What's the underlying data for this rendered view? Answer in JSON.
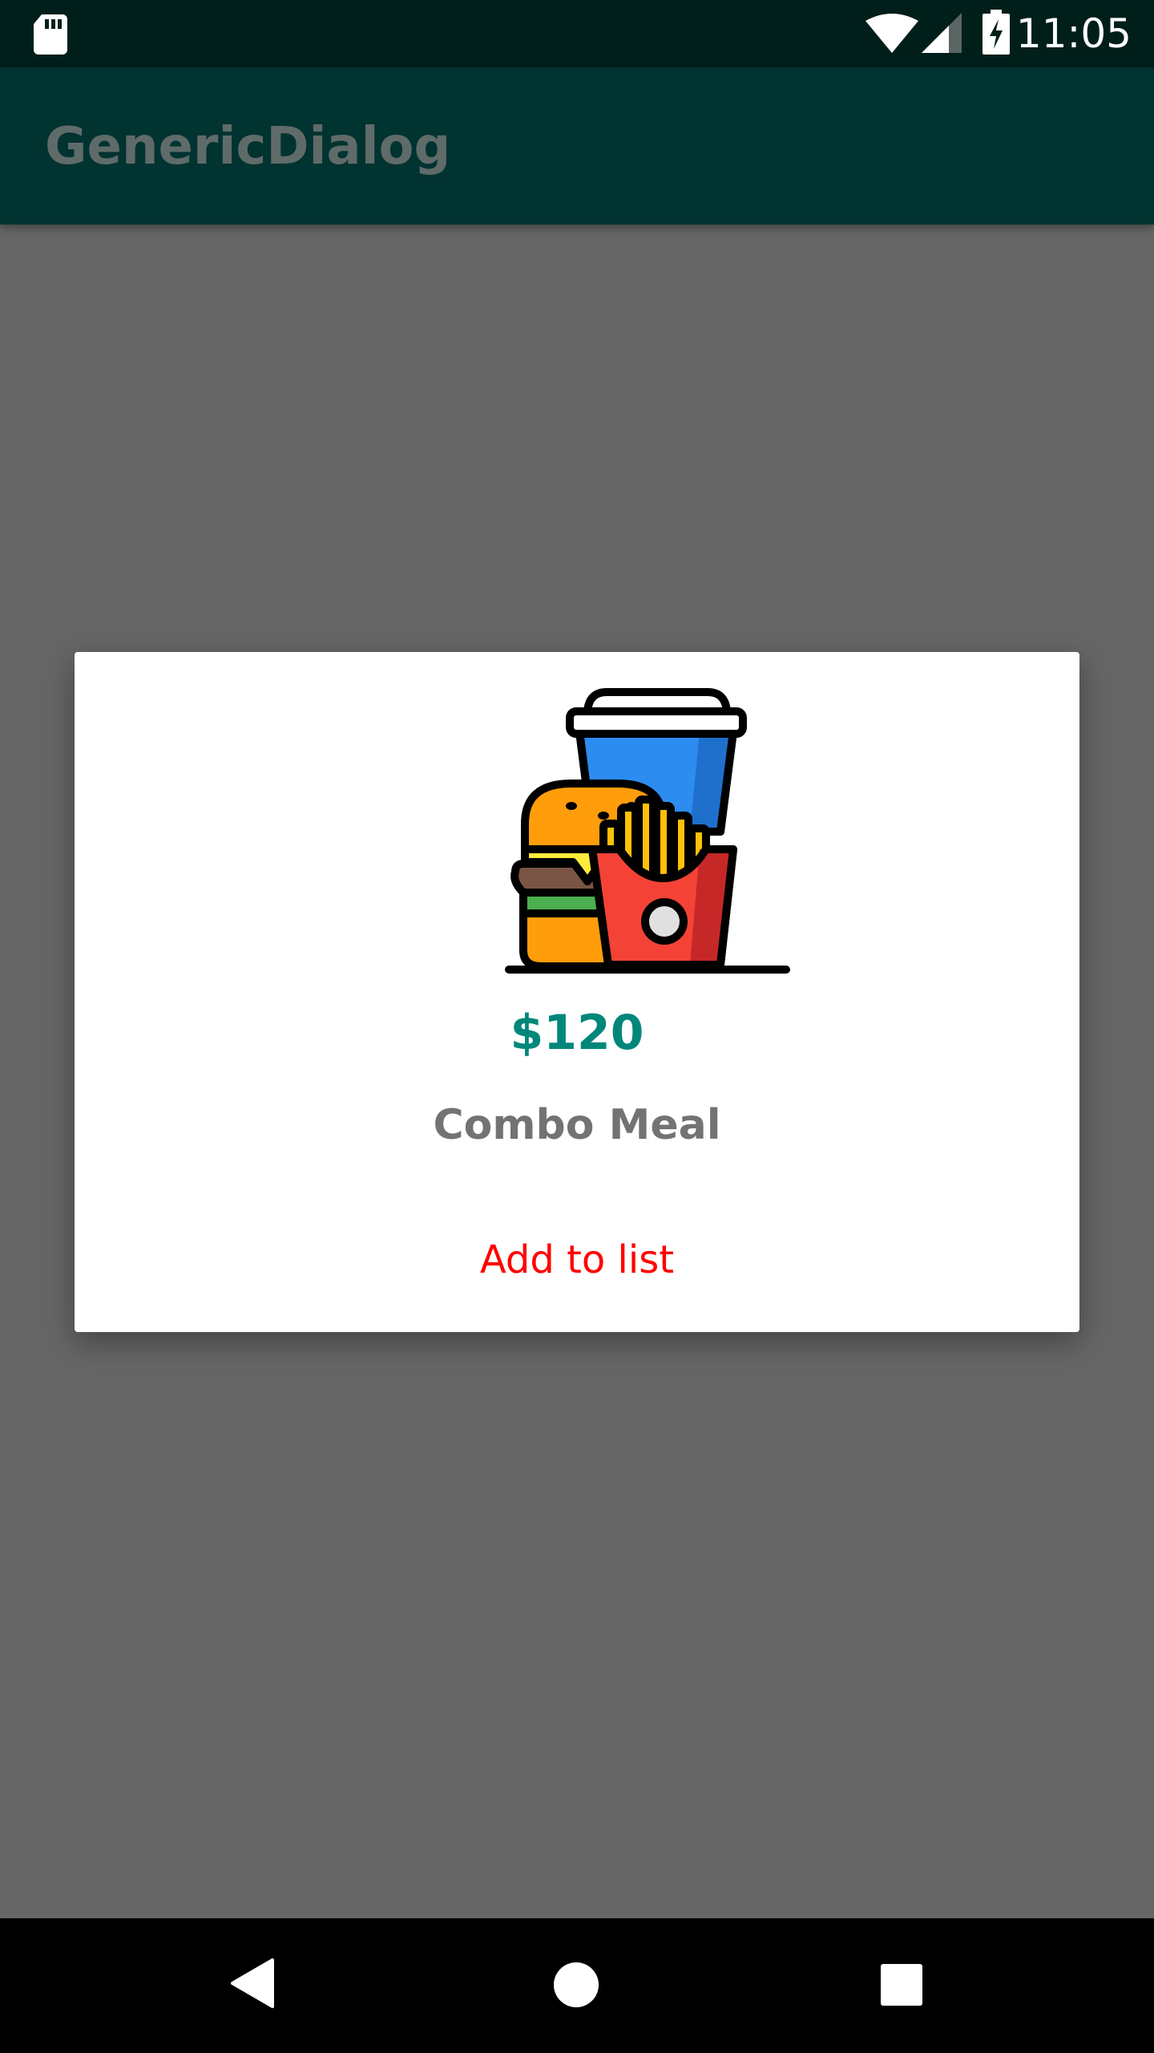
{
  "status_bar": {
    "time": "11:05",
    "icons": [
      "sd-card-icon",
      "wifi-icon",
      "cell-signal-icon",
      "battery-charging-icon"
    ]
  },
  "app_bar": {
    "title": "GenericDialog"
  },
  "dialog": {
    "image_icon": "combo-meal-icon",
    "price": "$120",
    "item_name": "Combo Meal",
    "action_label": "Add to list"
  },
  "nav_bar": {
    "icons": [
      "back-icon",
      "home-icon",
      "recents-icon"
    ]
  },
  "colors": {
    "status_bar_bg": "#011f1a",
    "app_bar_bg": "#013330",
    "scrim": "#666666",
    "price": "#00877a",
    "item_name": "#737373",
    "action": "#ff0000"
  }
}
